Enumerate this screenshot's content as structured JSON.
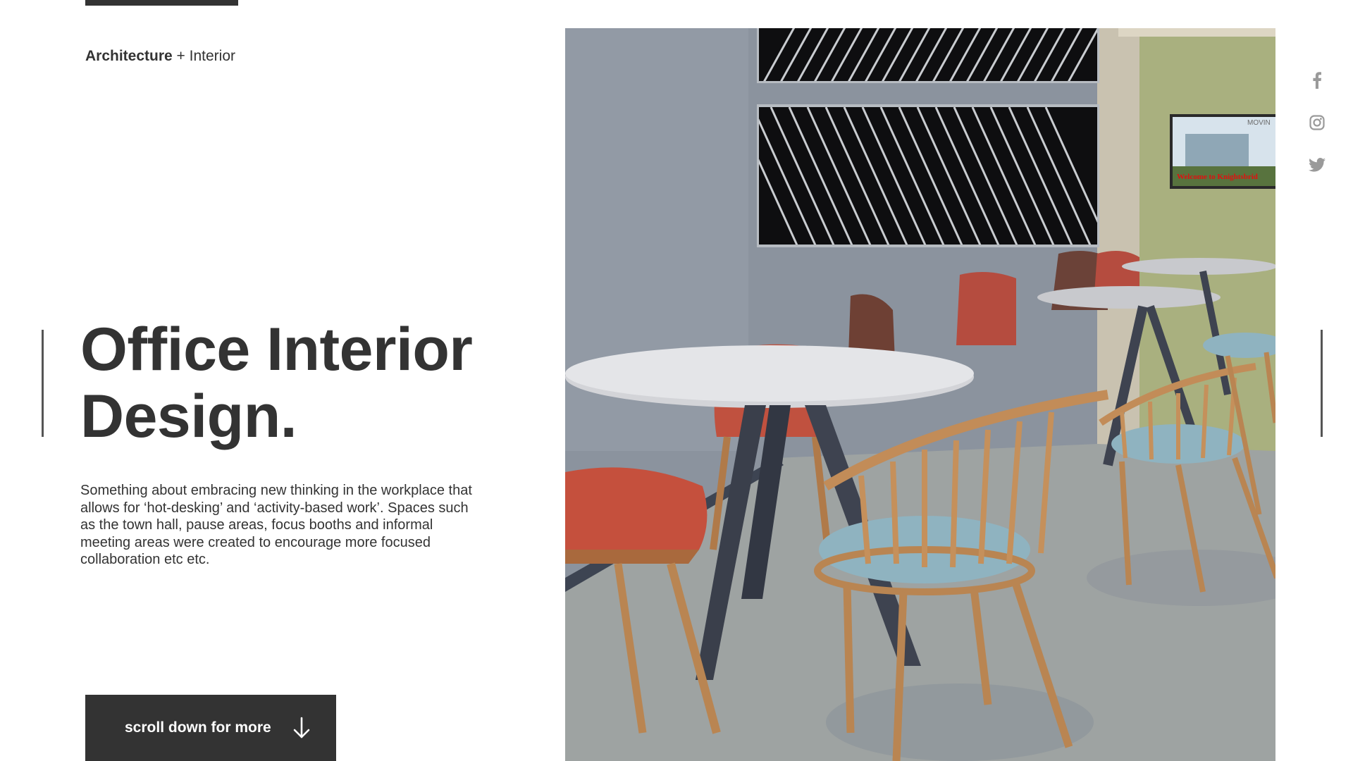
{
  "brand": {
    "bold": "Architecture",
    "rest": " + Interior"
  },
  "hero": {
    "title_line1": "Office Interior",
    "title_line2": "Design.",
    "description": "Something about embracing new thinking in the workplace that allows for ‘hot-desking’ and ‘activity-based work’. Spaces such as the town hall, pause areas, focus booths and informal meeting areas were created to encourage more focused collaboration etc etc."
  },
  "scroll_button": {
    "label": "scroll down for more",
    "icon": "arrow-down-icon"
  },
  "photo": {
    "subject": "office break area with round white tables, red and wooden chairs",
    "tv_text": "Welcome to Knightsbrid",
    "tv_logo_text": "MOVIN"
  },
  "social": [
    {
      "name": "facebook",
      "icon": "facebook-icon"
    },
    {
      "name": "instagram",
      "icon": "instagram-icon"
    },
    {
      "name": "twitter",
      "icon": "twitter-icon"
    }
  ],
  "colors": {
    "text": "#333333",
    "button_bg": "#333333",
    "social_icon": "#9a9a9a",
    "background": "#ffffff"
  }
}
